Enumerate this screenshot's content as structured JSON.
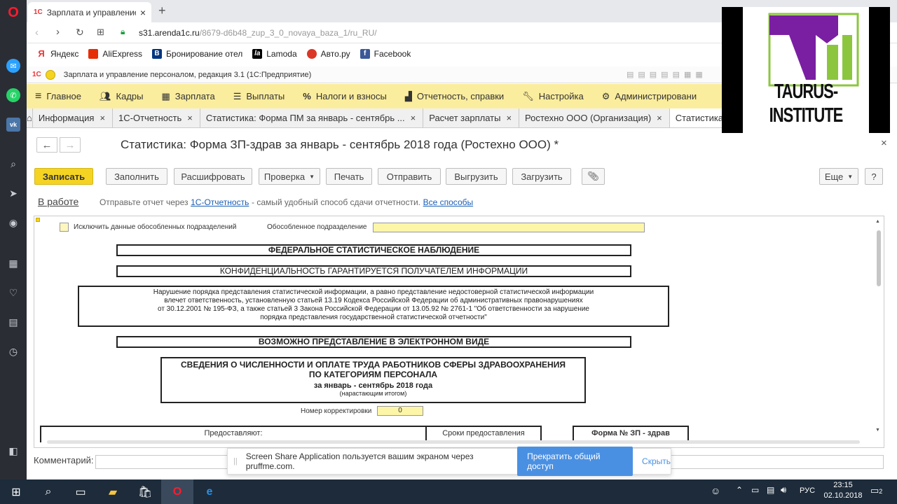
{
  "browser": {
    "tab_title": "Зарплата и управление п",
    "url_host": "s31.arenda1c.ru",
    "url_path": "/8679-d6b48_zup_3_0_novaya_baza_1/ru_RU/",
    "bookmarks": [
      "Яндекс",
      "AliExpress",
      "Бронирование отел",
      "Lamoda",
      "Авто.ру",
      "Facebook"
    ]
  },
  "app": {
    "title": "Зарплата и управление персоналом, редакция 3.1  (1С:Предприятие)",
    "menu": [
      "Главное",
      "Кадры",
      "Зарплата",
      "Выплаты",
      "Налоги и взносы",
      "Отчетность, справки",
      "Настройка",
      "Администрировани"
    ],
    "doc_tabs": [
      "Информация",
      "1С-Отчетность",
      "Статистика: Форма ПМ за январь - сентябрь ...",
      "Расчет зарплаты",
      "Ростехно ООО (Организация)",
      "Статистика: Ф"
    ]
  },
  "logo": {
    "text": "TAURUS-INSTITUTE",
    "color_purple": "#7a1fa2",
    "color_green": "#8cc63f"
  },
  "form": {
    "title": "Статистика: Форма ЗП-здрав за январь - сентябрь 2018 года (Ростехно ООО) *",
    "buttons": {
      "save": "Записать",
      "fill": "Заполнить",
      "decode": "Расшифровать",
      "check": "Проверка",
      "print": "Печать",
      "send": "Отправить",
      "export": "Выгрузить",
      "import": "Загрузить",
      "more": "Еще",
      "help": "?"
    },
    "status_link": "В работе",
    "hint_prefix": "Отправьте отчет через",
    "hint_link": "1С-Отчетность",
    "hint_suffix": "- самый удобный способ сдачи отчетности.",
    "hint_all": "Все способы"
  },
  "report": {
    "exclude_label": "Исключить данные обособленных подразделений",
    "subdivision_label": "Обособленное подразделение",
    "federal": "ФЕДЕРАЛЬНОЕ СТАТИСТИЧЕСКОЕ НАБЛЮДЕНИЕ",
    "confidential": "КОНФИДЕНЦИАЛЬНОСТЬ ГАРАНТИРУЕТСЯ ПОЛУЧАТЕЛЕМ ИНФОРМАЦИИ",
    "warning": [
      "Нарушение порядка представления статистической информации, а равно представление недостоверной статистической информации",
      "влечет ответственность, установленную статьей 13.19 Кодекса Российской Федерации об административных правонарушениях",
      "от 30.12.2001 № 195-ФЗ, а также статьей 3 Закона Российской Федерации от 13.05.92 № 2761-1 \"Об ответственности за нарушение",
      "порядка представления государственной статистической отчетности\""
    ],
    "electronic": "ВОЗМОЖНО ПРЕДСТАВЛЕНИЕ В ЭЛЕКТРОННОМ ВИДЕ",
    "heading1": "СВЕДЕНИЯ О ЧИСЛЕННОСТИ И ОПЛАТЕ ТРУДА РАБОТНИКОВ СФЕРЫ ЗДРАВООХРАНЕНИЯ",
    "heading2": "ПО КАТЕГОРИЯМ ПЕРСОНАЛА",
    "period": "за январь - сентябрь 2018 года",
    "cumulative": "(нарастающим итогом)",
    "correction_label": "Номер корректировки",
    "correction_value": "0",
    "col_provide": "Предоставляют:",
    "col_deadline": "Сроки предоставления",
    "col_form": "Форма № ЗП - здрав"
  },
  "comment_label": "Комментарий:",
  "notification": {
    "text": "Screen Share Application пользуется вашим экраном через pruffme.com.",
    "stop": "Прекратить общий доступ",
    "hide": "Скрыть"
  },
  "taskbar": {
    "lang": "РУС",
    "time": "23:15",
    "date": "02.10.2018",
    "notif_count": "2"
  }
}
